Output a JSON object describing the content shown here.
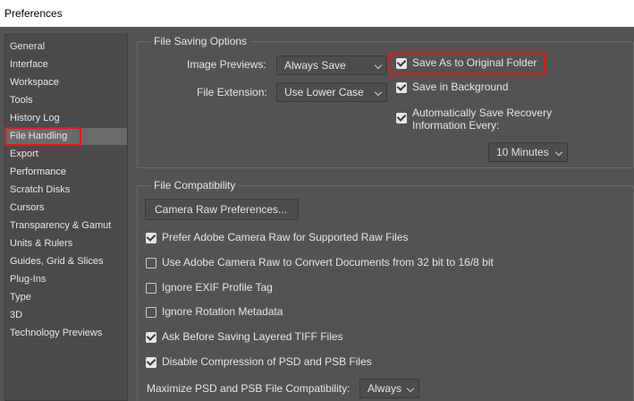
{
  "window": {
    "title": "Preferences"
  },
  "sidebar": {
    "items": [
      {
        "label": "General"
      },
      {
        "label": "Interface"
      },
      {
        "label": "Workspace"
      },
      {
        "label": "Tools"
      },
      {
        "label": "History Log"
      },
      {
        "label": "File Handling"
      },
      {
        "label": "Export"
      },
      {
        "label": "Performance"
      },
      {
        "label": "Scratch Disks"
      },
      {
        "label": "Cursors"
      },
      {
        "label": "Transparency & Gamut"
      },
      {
        "label": "Units & Rulers"
      },
      {
        "label": "Guides, Grid & Slices"
      },
      {
        "label": "Plug-Ins"
      },
      {
        "label": "Type"
      },
      {
        "label": "3D"
      },
      {
        "label": "Technology Previews"
      }
    ],
    "selected": "File Handling"
  },
  "file_saving": {
    "title": "File Saving Options",
    "image_previews_label": "Image Previews:",
    "image_previews_value": "Always Save",
    "file_extension_label": "File Extension:",
    "file_extension_value": "Use Lower Case",
    "save_as_original": {
      "label": "Save As to Original Folder",
      "checked": true
    },
    "save_in_background": {
      "label": "Save in Background",
      "checked": true
    },
    "auto_save": {
      "label_line1": "Automatically Save Recovery",
      "label_line2": "Information Every:",
      "checked": true
    },
    "auto_save_interval": "10 Minutes"
  },
  "file_compat": {
    "title": "File Compatibility",
    "camera_raw_button": "Camera Raw Preferences...",
    "options": [
      {
        "label": "Prefer Adobe Camera Raw for Supported Raw Files",
        "checked": true
      },
      {
        "label": "Use Adobe Camera Raw to Convert Documents from 32 bit to 16/8 bit",
        "checked": false
      },
      {
        "label": "Ignore EXIF Profile Tag",
        "checked": false
      },
      {
        "label": "Ignore Rotation Metadata",
        "checked": false
      },
      {
        "label": "Ask Before Saving Layered TIFF Files",
        "checked": true
      },
      {
        "label": "Disable Compression of PSD and PSB Files",
        "checked": true
      }
    ],
    "maximize_label": "Maximize PSD and PSB File Compatibility:",
    "maximize_value": "Always"
  },
  "colors": {
    "highlight": "#e0191f",
    "background": "#535353"
  }
}
